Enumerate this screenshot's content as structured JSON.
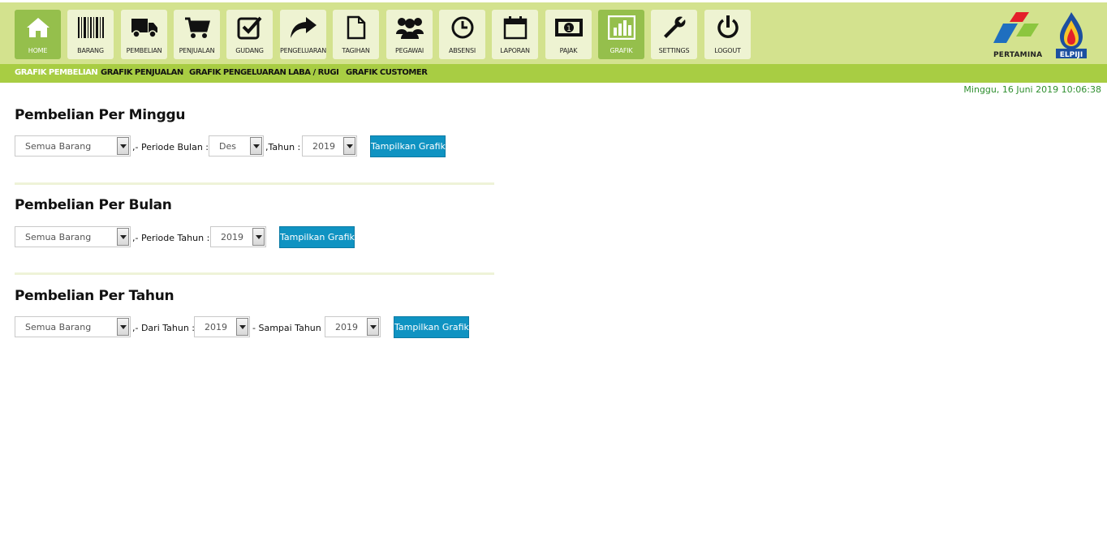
{
  "nav": {
    "items": [
      {
        "label": "HOME",
        "icon": "home-icon"
      },
      {
        "label": "BARANG",
        "icon": "barcode-icon"
      },
      {
        "label": "PEMBELIAN",
        "icon": "truck-icon"
      },
      {
        "label": "PENJUALAN",
        "icon": "cart-icon"
      },
      {
        "label": "GUDANG",
        "icon": "checkbox-icon"
      },
      {
        "label": "PENGELUARAN",
        "icon": "share-arrow-icon"
      },
      {
        "label": "TAGIHAN",
        "icon": "document-icon"
      },
      {
        "label": "PEGAWAI",
        "icon": "users-icon"
      },
      {
        "label": "ABSENSI",
        "icon": "clock-icon"
      },
      {
        "label": "LAPORAN",
        "icon": "calendar-icon"
      },
      {
        "label": "PAJAK",
        "icon": "money-icon"
      },
      {
        "label": "GRAFIK",
        "icon": "bar-chart-icon"
      },
      {
        "label": "SETTINGS",
        "icon": "wrench-icon"
      },
      {
        "label": "LOGOUT",
        "icon": "power-icon"
      }
    ],
    "active": "GRAFIK"
  },
  "logos": {
    "pertamina": "PERTAMINA",
    "elpiji": "ELPIJI"
  },
  "subnav": {
    "items": [
      "GRAFIK PEMBELIAN",
      "GRAFIK PENJUALAN",
      "GRAFIK PENGELUARAN",
      "LABA / RUGI",
      "GRAFIK CUSTOMER"
    ],
    "active": "GRAFIK PEMBELIAN"
  },
  "datetime": "Minggu, 16 Juni 2019 10:06:38",
  "sections": {
    "weekly": {
      "title": "Pembelian Per Minggu",
      "item_select": "Semua Barang",
      "label_periode": ",- Periode Bulan :",
      "month_select": "Des",
      "label_tahun": ",Tahun :",
      "year_select": "2019",
      "button": "Tampilkan Grafik"
    },
    "monthly": {
      "title": "Pembelian Per Bulan",
      "item_select": "Semua Barang",
      "label_periode": ",- Periode Tahun :",
      "year_select": "2019",
      "button": "Tampilkan Grafik"
    },
    "yearly": {
      "title": "Pembelian Per Tahun",
      "item_select": "Semua Barang",
      "label_dari": ",- Dari Tahun :",
      "from_select": "2019",
      "label_sampai": "- Sampai Tahun :",
      "to_select": "2019",
      "button": "Tampilkan Grafik"
    }
  },
  "colors": {
    "topbar": "#d3e28e",
    "subbar": "#a8cd43",
    "active_tab": "#95bf4c",
    "button": "#0f93c2",
    "datetime": "#2f8f2f"
  }
}
